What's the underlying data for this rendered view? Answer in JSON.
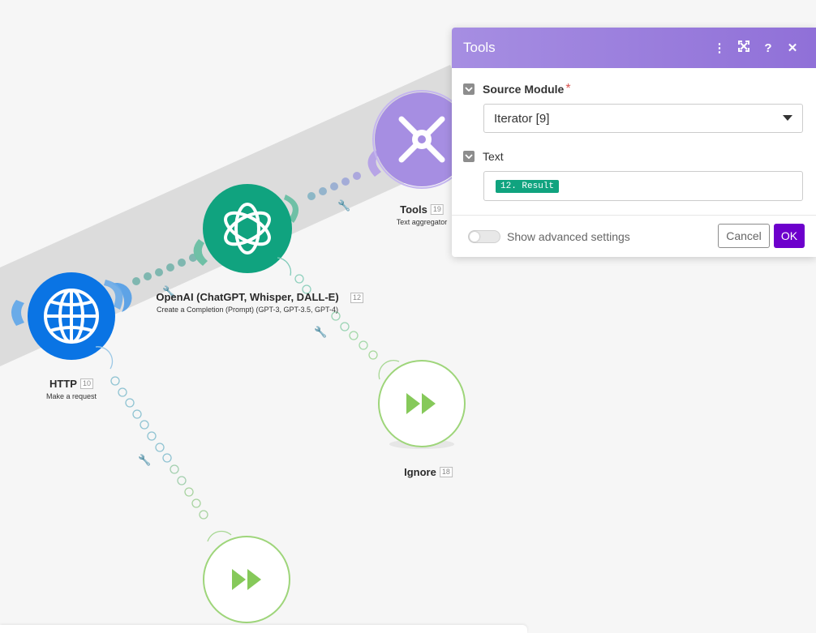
{
  "modules": {
    "http": {
      "name": "HTTP",
      "id": "10",
      "sub": "Make a request"
    },
    "openai": {
      "name": "OpenAI (ChatGPT, Whisper, DALL-E)",
      "id": "12",
      "sub": "Create a Completion (Prompt) (GPT-3, GPT-3.5, GPT-4)"
    },
    "tools": {
      "name": "Tools",
      "id": "19",
      "sub": "Text aggregator"
    },
    "ignore": {
      "name": "Ignore",
      "id": "18"
    }
  },
  "panel": {
    "title": "Tools",
    "header_icons": [
      "more-vertical-icon",
      "expand-icon",
      "help-icon",
      "close-icon"
    ],
    "source_module_label": "Source Module",
    "required_mark": "*",
    "source_module_value": "Iterator [9]",
    "text_label": "Text",
    "text_token": "12. Result",
    "advanced_label": "Show advanced settings",
    "cancel_label": "Cancel",
    "ok_label": "OK"
  },
  "colors": {
    "http": "#0074e4",
    "openai": "#10a37f",
    "tools": "#a68ee2",
    "ignore_outline": "#9ed57a",
    "ok_button": "#6d00cc",
    "header_gradient_start": "#a68ee2",
    "header_gradient_end": "#9070d8"
  }
}
